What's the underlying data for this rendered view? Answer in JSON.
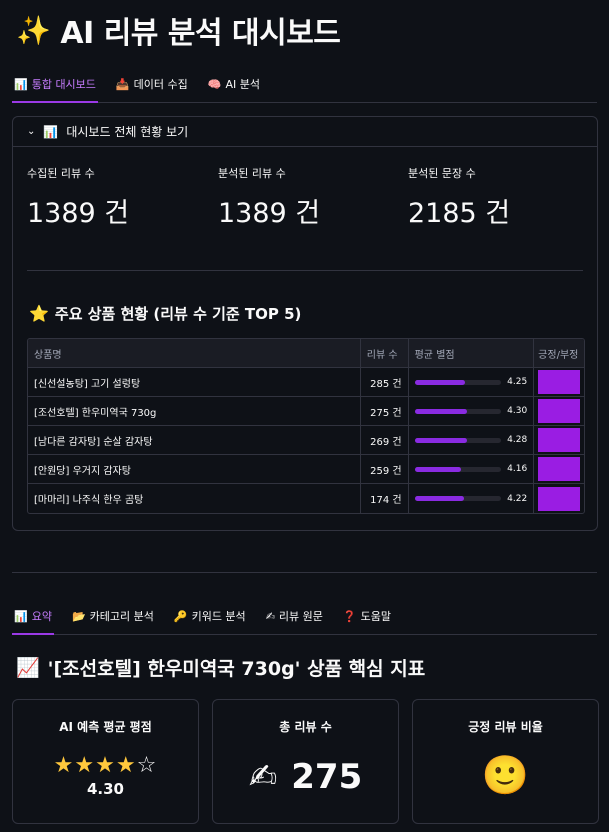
{
  "title": {
    "icon": "sparkles-icon",
    "text": "AI 리뷰 분석 대시보드"
  },
  "top_tabs": [
    {
      "icon": "📊",
      "label": "통합 대시보드",
      "active": true
    },
    {
      "icon": "📥",
      "label": "데이터 수집",
      "active": false
    },
    {
      "icon": "🧠",
      "label": "AI 분석",
      "active": false
    }
  ],
  "expander": {
    "label": "대시보드 전체 현황 보기",
    "icon": "📊",
    "metrics": [
      {
        "label": "수집된 리뷰 수",
        "value": "1389 건"
      },
      {
        "label": "분석된 리뷰 수",
        "value": "1389 건"
      },
      {
        "label": "분석된 문장 수",
        "value": "2185 건"
      }
    ],
    "top_products": {
      "title": "주요 상품 현황 (리뷰 수 기준 TOP 5)",
      "columns": [
        "상품명",
        "리뷰 수",
        "평균 별점",
        "긍정/부정"
      ],
      "rows": [
        {
          "name": "[신선설농탕] 고기 설렁탕",
          "reviews": "285 건",
          "rating": "4.25",
          "rating_value": 4.25
        },
        {
          "name": "[조선호텔] 한우미역국 730g",
          "reviews": "275 건",
          "rating": "4.30",
          "rating_value": 4.3
        },
        {
          "name": "[남다른 감자탕] 순살 감자탕",
          "reviews": "269 건",
          "rating": "4.28",
          "rating_value": 4.28
        },
        {
          "name": "[안원당] 우거지 감자탕",
          "reviews": "259 건",
          "rating": "4.16",
          "rating_value": 4.16
        },
        {
          "name": "[마마리] 나주식 한우 곰탕",
          "reviews": "174 건",
          "rating": "4.22",
          "rating_value": 4.22
        }
      ],
      "rating_max": 5,
      "accent": "#8a2be2"
    }
  },
  "sub_tabs": [
    {
      "icon": "📊",
      "label": "요약",
      "active": true
    },
    {
      "icon": "📂",
      "label": "카테고리 분석",
      "active": false
    },
    {
      "icon": "🔑",
      "label": "키워드 분석",
      "active": false
    },
    {
      "icon": "✍",
      "label": "리뷰 원문",
      "active": false
    },
    {
      "icon": "❓",
      "label": "도움말",
      "active": false
    }
  ],
  "product_section": {
    "icon": "📈",
    "title": "'[조선호텔] 한우미역국 730g' 상품 핵심 지표",
    "cards": {
      "rating": {
        "label": "AI 예측 평균 평점",
        "stars_filled": 4,
        "stars_total": 5,
        "value": "4.30"
      },
      "reviews": {
        "label": "총 리뷰 수",
        "icon": "✍",
        "value": "275"
      },
      "positive": {
        "label": "긍정 리뷰 비율",
        "icon": "🙂"
      }
    }
  }
}
